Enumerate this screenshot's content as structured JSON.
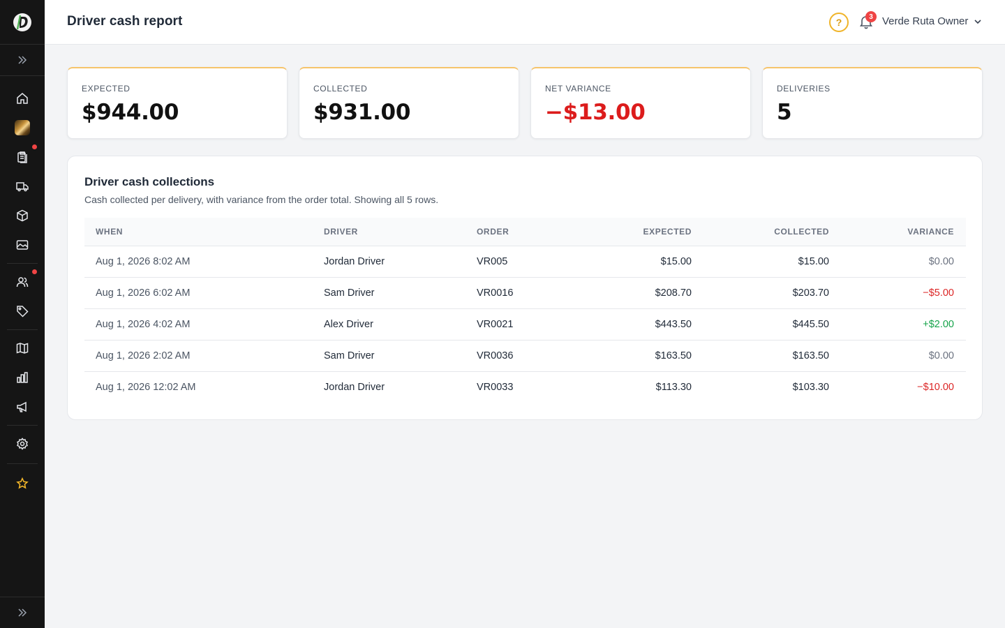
{
  "header": {
    "title": "Driver cash report",
    "help_glyph": "?",
    "notification_count": "3",
    "user_name": "Verde Ruta Owner"
  },
  "sidebar": {
    "icons": [
      "logo",
      "expand-icon",
      "home-icon",
      "avatar-thumbnail",
      "clipboard-icon",
      "truck-icon",
      "package-icon",
      "image-icon",
      "users-icon",
      "tag-icon",
      "map-icon",
      "chart-icon",
      "megaphone-icon",
      "settings-icon",
      "star-icon",
      "expand-icon"
    ]
  },
  "stats": [
    {
      "label": "EXPECTED",
      "value": "$944.00"
    },
    {
      "label": "COLLECTED",
      "value": "$931.00"
    },
    {
      "label": "NET VARIANCE",
      "value": "−$13.00"
    },
    {
      "label": "DELIVERIES",
      "value": "5"
    }
  ],
  "panel": {
    "title": "Driver cash collections",
    "subtitle": "Cash collected per delivery, with variance from the order total. Showing all 5 rows."
  },
  "table": {
    "headers": {
      "when": "WHEN",
      "driver": "DRIVER",
      "order": "ORDER",
      "expected": "EXPECTED",
      "collected": "COLLECTED",
      "variance": "VARIANCE"
    },
    "rows": [
      {
        "when": "Aug 1, 2026 8:02 AM",
        "driver": "Jordan Driver",
        "order": "VR005",
        "expected": "$15.00",
        "collected": "$15.00",
        "variance": "$0.00"
      },
      {
        "when": "Aug 1, 2026 6:02 AM",
        "driver": "Sam Driver",
        "order": "VR0016",
        "expected": "$208.70",
        "collected": "$203.70",
        "variance": "−$5.00"
      },
      {
        "when": "Aug 1, 2026 4:02 AM",
        "driver": "Alex Driver",
        "order": "VR0021",
        "expected": "$443.50",
        "collected": "$445.50",
        "variance": "+$2.00"
      },
      {
        "when": "Aug 1, 2026 2:02 AM",
        "driver": "Sam Driver",
        "order": "VR0036",
        "expected": "$163.50",
        "collected": "$163.50",
        "variance": "$0.00"
      },
      {
        "when": "Aug 1, 2026 12:02 AM",
        "driver": "Jordan Driver",
        "order": "VR0033",
        "expected": "$113.30",
        "collected": "$103.30",
        "variance": "−$10.00"
      }
    ]
  },
  "colors": {
    "accent": "#f0b429",
    "negative": "#dc2626",
    "positive": "#16a34a",
    "sidebar_bg": "#151515"
  }
}
